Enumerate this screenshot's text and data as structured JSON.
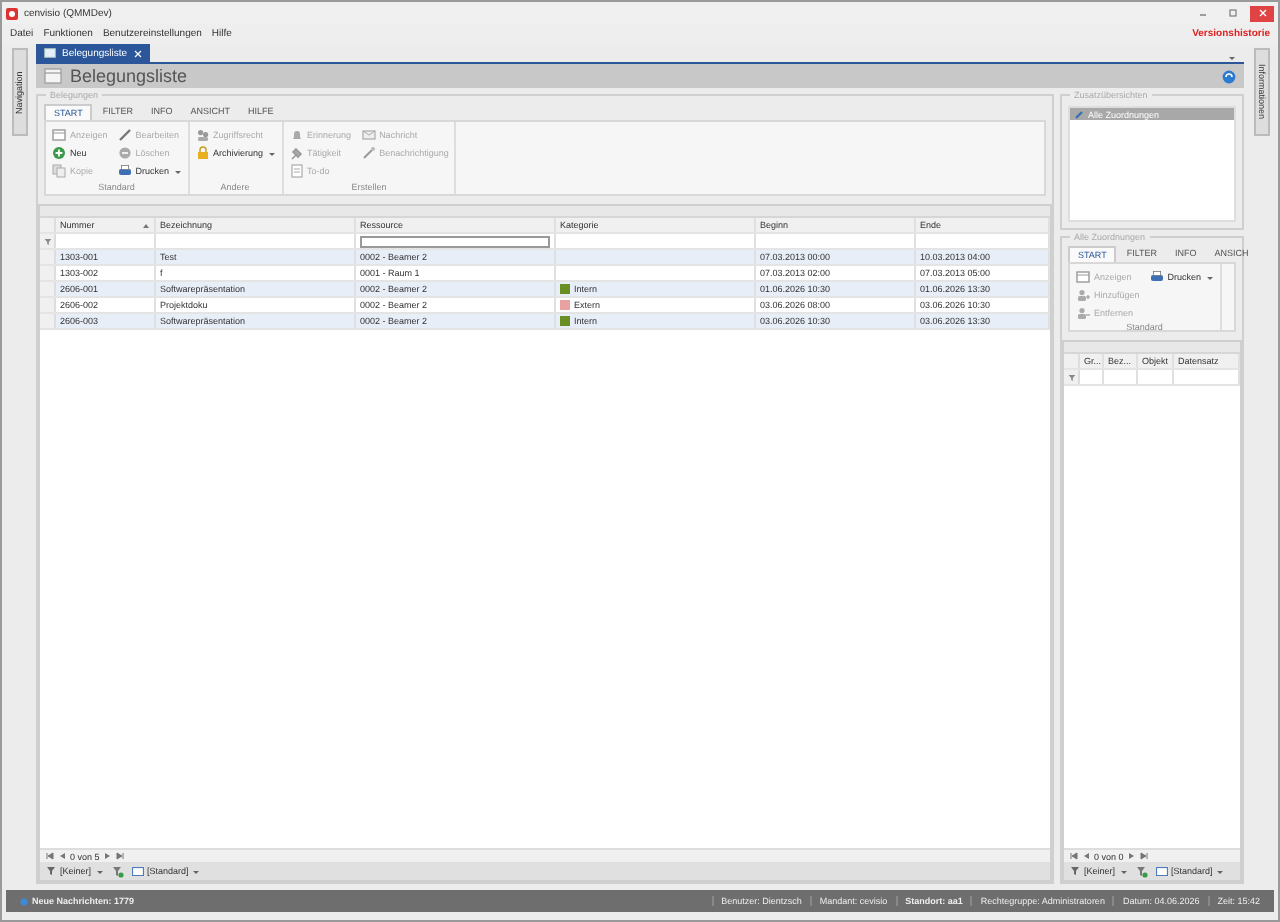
{
  "window": {
    "title": "cenvisio (QMMDev)"
  },
  "menu": [
    "Datei",
    "Funktionen",
    "Benutzereinstellungen",
    "Hilfe"
  ],
  "version_link": "Versionshistorie",
  "side_tabs": {
    "left": "Navigation",
    "right": "Informationen"
  },
  "doc_tabs": [
    {
      "label": "Belegungsliste",
      "selected": true
    }
  ],
  "page_title": "Belegungsliste",
  "main": {
    "group_title": "Belegungen",
    "ribbon_tabs": [
      {
        "label": "START",
        "selected": true
      },
      {
        "label": "FILTER",
        "selected": false
      },
      {
        "label": "INFO",
        "selected": false
      },
      {
        "label": "ANSICHT",
        "selected": false
      },
      {
        "label": "HILFE",
        "selected": false
      }
    ],
    "ribbon_groups": [
      {
        "title": "Standard",
        "buttons": [
          {
            "label": "Anzeigen",
            "disabled": true,
            "dropdown": false
          },
          {
            "label": "Neu",
            "disabled": false,
            "dropdown": false
          },
          {
            "label": "Kopie",
            "disabled": true,
            "dropdown": false
          },
          {
            "label": "Bearbeiten",
            "disabled": true,
            "dropdown": false
          },
          {
            "label": "Löschen",
            "disabled": true,
            "dropdown": false
          },
          {
            "label": "Drucken",
            "disabled": false,
            "dropdown": true
          }
        ]
      },
      {
        "title": "Andere",
        "buttons": [
          {
            "label": "Zugriffsrecht",
            "disabled": true,
            "dropdown": false
          },
          {
            "label": "Archivierung",
            "disabled": false,
            "dropdown": true
          }
        ]
      },
      {
        "title": "Erstellen",
        "buttons": [
          {
            "label": "Erinnerung",
            "disabled": true,
            "dropdown": false
          },
          {
            "label": "Tätigkeit",
            "disabled": true,
            "dropdown": false
          },
          {
            "label": "To-do",
            "disabled": true,
            "dropdown": false
          },
          {
            "label": "Nachricht",
            "disabled": true,
            "dropdown": false
          },
          {
            "label": "Benachrichtigung",
            "disabled": true,
            "dropdown": false
          }
        ]
      }
    ],
    "table": {
      "columns": [
        {
          "label": "Nummer",
          "sorted": true
        },
        {
          "label": "Bezeichnung",
          "sorted": false
        },
        {
          "label": "Ressource",
          "sorted": false
        },
        {
          "label": "Kategorie",
          "sorted": false
        },
        {
          "label": "Beginn",
          "sorted": false
        },
        {
          "label": "Ende",
          "sorted": false
        }
      ],
      "rows": [
        {
          "nummer": "1303-001",
          "bezeichnung": "Test",
          "ressource": "0002 - Beamer 2",
          "beginn": "07.03.2013 00:00",
          "ende": "10.03.2013 04:00"
        },
        {
          "nummer": "1303-002",
          "bezeichnung": "f",
          "ressource": "0001 - Raum 1",
          "beginn": "07.03.2013 02:00",
          "ende": "07.03.2013 05:00"
        },
        {
          "nummer": "2606-001",
          "bezeichnung": "Softwarepräsentation",
          "ressource": "0002 - Beamer 2",
          "kategorie": {
            "label": "Intern",
            "color": "#6b8e23"
          },
          "beginn": "01.06.2026 10:30",
          "ende": "01.06.2026 13:30"
        },
        {
          "nummer": "2606-002",
          "bezeichnung": "Projektdoku",
          "ressource": "0002 - Beamer 2",
          "kategorie": {
            "label": "Extern",
            "color": "#e8a0a0"
          },
          "beginn": "03.06.2026 08:00",
          "ende": "03.06.2026 10:30"
        },
        {
          "nummer": "2606-003",
          "bezeichnung": "Softwarepräsentation",
          "ressource": "0002 - Beamer 2",
          "kategorie": {
            "label": "Intern",
            "color": "#6b8e23"
          },
          "beginn": "03.06.2026 10:30",
          "ende": "03.06.2026 13:30"
        }
      ]
    },
    "pager": "0 von 5",
    "footer": {
      "filter": "[Keiner]",
      "layout": "[Standard]"
    }
  },
  "side": {
    "overview_title": "Zusatzübersichten",
    "overview_items": [
      {
        "label": "Alle Zuordnungen",
        "selected": true
      }
    ],
    "group_title": "Alle Zuordnungen",
    "ribbon_tabs": [
      {
        "label": "START",
        "selected": true
      },
      {
        "label": "FILTER",
        "selected": false
      },
      {
        "label": "INFO",
        "selected": false
      },
      {
        "label": "ANSICH",
        "selected": false
      }
    ],
    "ribbon_group": {
      "title": "Standard",
      "buttons": [
        {
          "label": "Anzeigen",
          "disabled": true,
          "dropdown": false
        },
        {
          "label": "Hinzufügen",
          "disabled": true,
          "dropdown": false
        },
        {
          "label": "Entfernen",
          "disabled": true,
          "dropdown": false
        },
        {
          "label": "Drucken",
          "disabled": false,
          "dropdown": true
        }
      ]
    },
    "table": {
      "columns": [
        "Gr...",
        "Bez...",
        "Objekt",
        "Datensatz"
      ]
    },
    "pager": "0 von 0",
    "footer": {
      "filter": "[Keiner]",
      "layout": "[Standard]"
    }
  },
  "status_bar": [
    {
      "text": "Neue Nachrichten: 1779",
      "bold": true
    },
    {
      "text": "Benutzer: Dientzsch",
      "bold": false
    },
    {
      "text": "Mandant: cevisio",
      "bold": false
    },
    {
      "text": "Standort: aa1",
      "bold": true
    },
    {
      "text": "Rechtegruppe: Administratoren",
      "bold": false
    },
    {
      "text": "Datum: 04.06.2026",
      "bold": false
    },
    {
      "text": "Zeit: 15:42",
      "bold": false
    }
  ]
}
